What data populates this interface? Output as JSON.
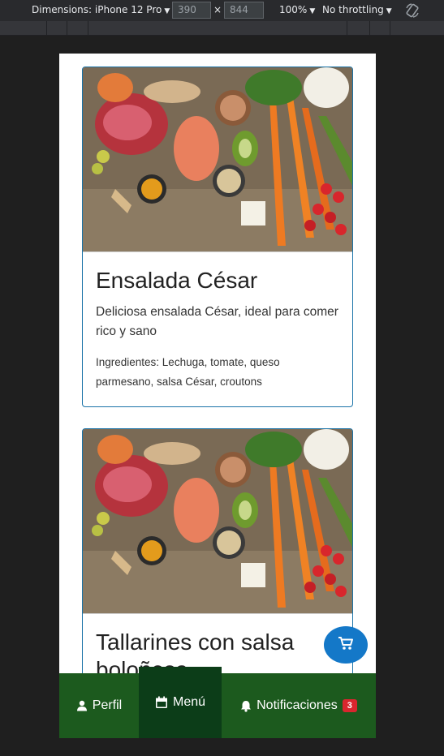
{
  "devtools": {
    "device_label": "Dimensions: iPhone 12 Pro",
    "width": "390",
    "height": "844",
    "times": "×",
    "zoom": "100%",
    "throttling": "No throttling",
    "rotate_icon": "rotate-icon"
  },
  "cards": [
    {
      "title": "Ensalada César",
      "description": "Deliciosa ensalada César, ideal para comer rico y sano",
      "ingredients": "Ingredientes: Lechuga, tomate, queso parmesano, salsa César, croutons"
    },
    {
      "title": "Tallarines con salsa boloñesa"
    }
  ],
  "nav": {
    "profile_label": "Perfil",
    "menu_label": "Menú",
    "notifications_label": "Notificaciones",
    "notifications_count": "3"
  },
  "colors": {
    "nav_bg": "#1c5a1e",
    "nav_active": "#0c3d18",
    "fab": "#1478c8",
    "badge": "#d9262e",
    "card_border": "#1a73a8"
  }
}
